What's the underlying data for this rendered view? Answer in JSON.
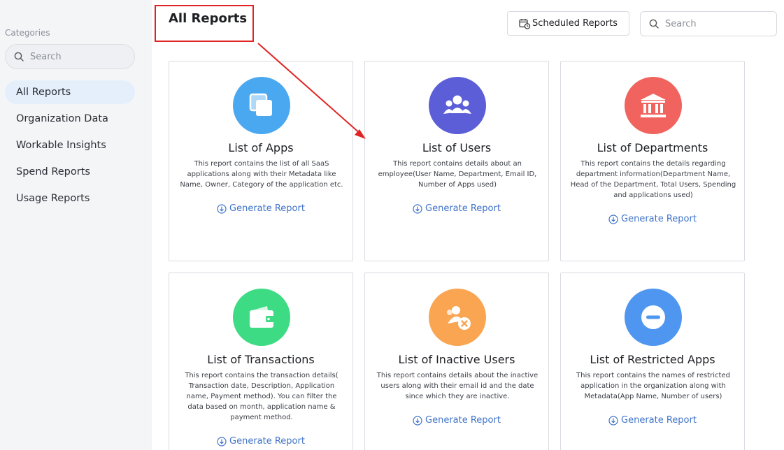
{
  "sidebar": {
    "categories_label": "Categories",
    "search_placeholder": "Search",
    "items": [
      {
        "label": "All Reports",
        "active": true
      },
      {
        "label": "Organization Data"
      },
      {
        "label": "Workable Insights"
      },
      {
        "label": "Spend Reports"
      },
      {
        "label": "Usage Reports"
      }
    ]
  },
  "header": {
    "title": "All Reports",
    "scheduled_label": "Scheduled Reports",
    "search_placeholder": "Search"
  },
  "cards": [
    {
      "title": "List of Apps",
      "icon": "apps-icon",
      "color": "#4aa8f0",
      "description": "This report contains the list of all SaaS applications along with their Metadata like Name, Owner, Category of the application etc.",
      "action": "Generate Report"
    },
    {
      "title": "List of Users",
      "icon": "users-icon",
      "color": "#5c5ed8",
      "description": "This report contains details about an employee(User Name, Department, Email ID, Number of Apps used)",
      "action": "Generate Report"
    },
    {
      "title": "List of Departments",
      "icon": "department-icon",
      "color": "#f0635e",
      "description": "This report contains the details regarding department information(Department Name, Head of the Department, Total Users, Spending and applications used)",
      "action": "Generate Report"
    },
    {
      "title": "List of Transactions",
      "icon": "wallet-icon",
      "color": "#3ddc84",
      "description": "This report contains the transaction details( Transaction date, Description, Application name, Payment method). You can filter the data based on month, application name & payment method.",
      "action": "Generate Report"
    },
    {
      "title": "List of Inactive Users",
      "icon": "inactive-user-icon",
      "color": "#f9a552",
      "description": "This report contains details about the inactive users along with their email id and the date since which they are inactive.",
      "action": "Generate Report"
    },
    {
      "title": "List of Restricted Apps",
      "icon": "restricted-icon",
      "color": "#4e96f0",
      "description": "This report contains the names of restricted application in the organization along with Metadata(App Name, Number of users)",
      "action": "Generate Report"
    }
  ],
  "colors": {
    "accent": "#3f73c8",
    "highlight": "#e02424"
  }
}
